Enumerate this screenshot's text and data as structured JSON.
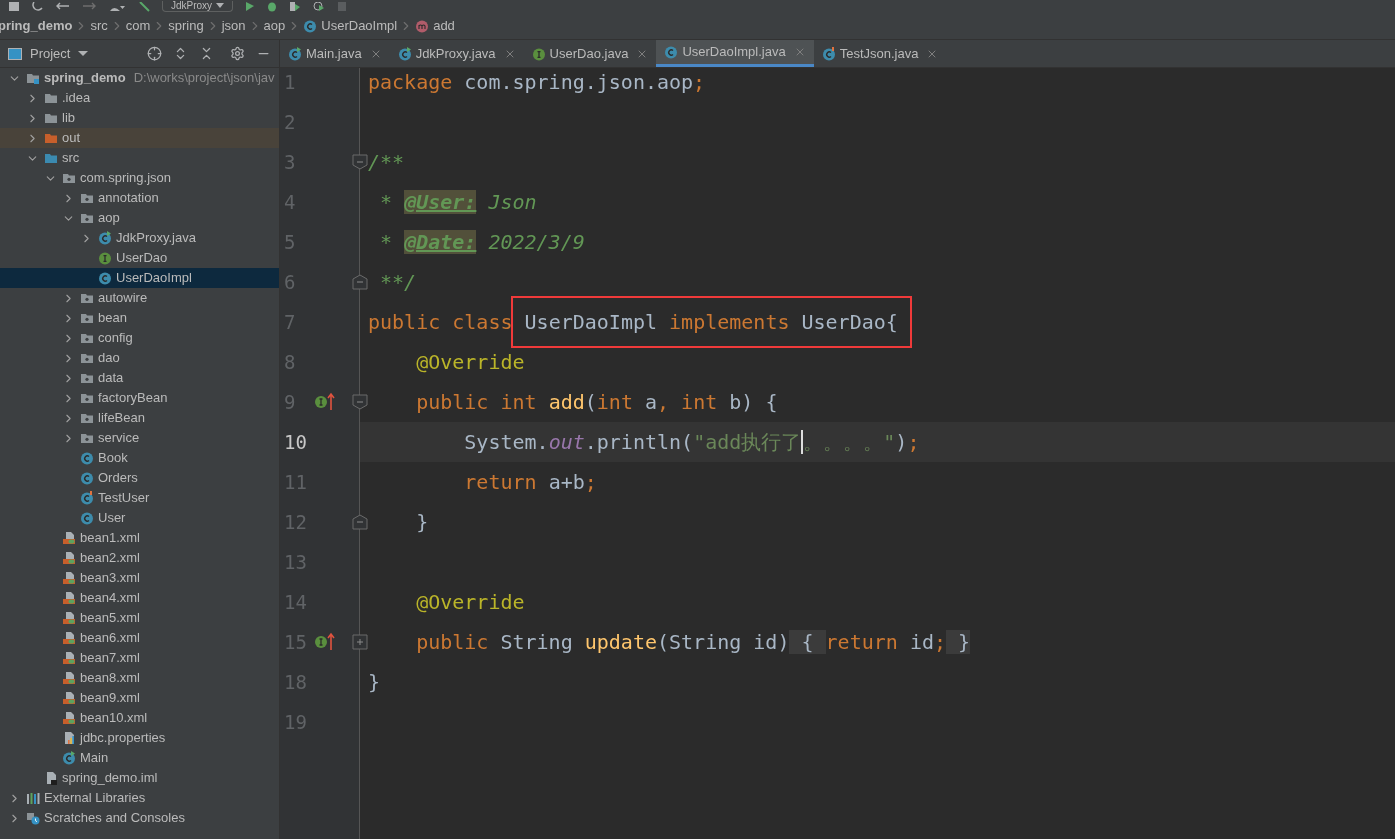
{
  "toolbar": {
    "run_config": "JdkProxy"
  },
  "breadcrumbs": [
    {
      "label": "pring_demo",
      "kind": "project"
    },
    {
      "label": "src",
      "kind": "dir"
    },
    {
      "label": "com",
      "kind": "dir"
    },
    {
      "label": "spring",
      "kind": "dir"
    },
    {
      "label": "json",
      "kind": "dir"
    },
    {
      "label": "aop",
      "kind": "dir"
    },
    {
      "label": "UserDaoImpl",
      "kind": "class"
    },
    {
      "label": "add",
      "kind": "method"
    }
  ],
  "project_panel": {
    "title": "Project",
    "tree": [
      {
        "label": "spring_demo",
        "hint": "D:\\works\\project\\json\\jav",
        "kind": "module",
        "expanded": true,
        "selected": false,
        "children": [
          {
            "label": ".idea",
            "kind": "folder",
            "expanded": false,
            "selected": false
          },
          {
            "label": "lib",
            "kind": "folder",
            "expanded": false,
            "selected": false
          },
          {
            "label": "out",
            "kind": "excluded",
            "expanded": false,
            "selected": false
          },
          {
            "label": "src",
            "kind": "source",
            "expanded": true,
            "selected": false,
            "children": [
              {
                "label": "com.spring.json",
                "kind": "package",
                "expanded": true,
                "selected": false,
                "children": [
                  {
                    "label": "annotation",
                    "kind": "package",
                    "expanded": false,
                    "selected": false
                  },
                  {
                    "label": "aop",
                    "kind": "package",
                    "expanded": true,
                    "selected": false,
                    "children": [
                      {
                        "label": "JdkProxy.java",
                        "kind": "class-run",
                        "expanded": false,
                        "selected": false
                      },
                      {
                        "label": "UserDao",
                        "kind": "interface",
                        "selected": false
                      },
                      {
                        "label": "UserDaoImpl",
                        "kind": "class",
                        "selected": true
                      }
                    ]
                  },
                  {
                    "label": "autowire",
                    "kind": "package",
                    "expanded": false,
                    "selected": false
                  },
                  {
                    "label": "bean",
                    "kind": "package",
                    "expanded": false,
                    "selected": false
                  },
                  {
                    "label": "config",
                    "kind": "package",
                    "expanded": false,
                    "selected": false
                  },
                  {
                    "label": "dao",
                    "kind": "package",
                    "expanded": false,
                    "selected": false
                  },
                  {
                    "label": "data",
                    "kind": "package",
                    "expanded": false,
                    "selected": false
                  },
                  {
                    "label": "factoryBean",
                    "kind": "package",
                    "expanded": false,
                    "selected": false
                  },
                  {
                    "label": "lifeBean",
                    "kind": "package",
                    "expanded": false,
                    "selected": false
                  },
                  {
                    "label": "service",
                    "kind": "package",
                    "expanded": false,
                    "selected": false
                  },
                  {
                    "label": "Book",
                    "kind": "class",
                    "selected": false
                  },
                  {
                    "label": "Orders",
                    "kind": "class",
                    "selected": false
                  },
                  {
                    "label": "TestUser",
                    "kind": "class-test",
                    "selected": false
                  },
                  {
                    "label": "User",
                    "kind": "class",
                    "selected": false
                  }
                ]
              },
              {
                "label": "bean1.xml",
                "kind": "xml",
                "selected": false
              },
              {
                "label": "bean2.xml",
                "kind": "xml",
                "selected": false
              },
              {
                "label": "bean3.xml",
                "kind": "xml",
                "selected": false
              },
              {
                "label": "bean4.xml",
                "kind": "xml",
                "selected": false
              },
              {
                "label": "bean5.xml",
                "kind": "xml",
                "selected": false
              },
              {
                "label": "bean6.xml",
                "kind": "xml",
                "selected": false
              },
              {
                "label": "bean7.xml",
                "kind": "xml",
                "selected": false
              },
              {
                "label": "bean8.xml",
                "kind": "xml",
                "selected": false
              },
              {
                "label": "bean9.xml",
                "kind": "xml",
                "selected": false
              },
              {
                "label": "bean10.xml",
                "kind": "xml",
                "selected": false
              },
              {
                "label": "jdbc.properties",
                "kind": "properties",
                "selected": false
              },
              {
                "label": "Main",
                "kind": "class-run",
                "selected": false
              }
            ]
          },
          {
            "label": "spring_demo.iml",
            "kind": "iml",
            "selected": false
          }
        ]
      },
      {
        "label": "External Libraries",
        "kind": "libraries",
        "expanded": false,
        "selected": false
      },
      {
        "label": "Scratches and Consoles",
        "kind": "scratches",
        "expanded": false,
        "selected": false
      }
    ]
  },
  "editor_tabs": [
    {
      "label": "Main.java",
      "kind": "class-run",
      "selected": false
    },
    {
      "label": "JdkProxy.java",
      "kind": "class-run",
      "selected": false
    },
    {
      "label": "UserDao.java",
      "kind": "interface",
      "selected": false
    },
    {
      "label": "UserDaoImpl.java",
      "kind": "class",
      "selected": true
    },
    {
      "label": "TestJson.java",
      "kind": "class-test",
      "selected": false
    }
  ],
  "code_lines": [
    {
      "number": "1",
      "tokens": [
        {
          "text": "package ",
          "kind": "keyword"
        },
        {
          "text": "com.spring.json.aop",
          "kind": "plain"
        },
        {
          "text": ";",
          "kind": "keyword"
        }
      ]
    },
    {
      "number": "2"
    },
    {
      "number": "3",
      "fold_start": true,
      "tokens": [
        {
          "text": "/**",
          "kind": "comment"
        }
      ]
    },
    {
      "number": "4",
      "tokens": [
        {
          "text": " * ",
          "kind": "comment"
        },
        {
          "text": "@User:",
          "kind": "doctag"
        },
        {
          "text": " Json",
          "kind": "comment"
        }
      ]
    },
    {
      "number": "5",
      "tokens": [
        {
          "text": " * ",
          "kind": "comment"
        },
        {
          "text": "@Date:",
          "kind": "doctag"
        },
        {
          "text": " 2022/3/9",
          "kind": "comment"
        }
      ]
    },
    {
      "number": "6",
      "fold_end": true,
      "tokens": [
        {
          "text": " **/",
          "kind": "comment"
        }
      ]
    },
    {
      "number": "7",
      "tokens": [
        {
          "text": "public class ",
          "kind": "keyword",
          "boxed": false
        },
        {
          "text": "UserDaoImpl ",
          "kind": "plain",
          "boxed": true
        },
        {
          "text": "implements ",
          "kind": "keyword",
          "boxed": true
        },
        {
          "text": "UserDao{",
          "kind": "plain",
          "boxed": true
        }
      ]
    },
    {
      "number": "8",
      "tokens": [
        {
          "text": "    @Override",
          "kind": "annotation"
        }
      ]
    },
    {
      "number": "9",
      "fold_start": true,
      "implements_marker": true,
      "tokens": [
        {
          "text": "    public int ",
          "kind": "keyword"
        },
        {
          "text": "add",
          "kind": "method"
        },
        {
          "text": "(",
          "kind": "plain"
        },
        {
          "text": "int ",
          "kind": "keyword"
        },
        {
          "text": "a",
          "kind": "plain"
        },
        {
          "text": ", ",
          "kind": "keyword"
        },
        {
          "text": "int ",
          "kind": "keyword"
        },
        {
          "text": "b) {",
          "kind": "plain"
        }
      ]
    },
    {
      "number": "10",
      "current": true,
      "tokens": [
        {
          "text": "        System.",
          "kind": "plain"
        },
        {
          "text": "out",
          "kind": "field"
        },
        {
          "text": ".println(",
          "kind": "plain"
        },
        {
          "text": "\"add执行了",
          "kind": "string",
          "caret": true
        },
        {
          "text": "。。。。\"",
          "kind": "string"
        },
        {
          "text": ")",
          "kind": "plain"
        },
        {
          "text": ";",
          "kind": "keyword"
        }
      ]
    },
    {
      "number": "11",
      "tokens": [
        {
          "text": "        return ",
          "kind": "keyword"
        },
        {
          "text": "a+b",
          "kind": "plain"
        },
        {
          "text": ";",
          "kind": "keyword"
        }
      ]
    },
    {
      "number": "12",
      "fold_end": true,
      "tokens": [
        {
          "text": "    }",
          "kind": "plain"
        }
      ]
    },
    {
      "number": "13"
    },
    {
      "number": "14",
      "tokens": [
        {
          "text": "    @Override",
          "kind": "annotation"
        }
      ]
    },
    {
      "number": "15",
      "fold_collapsed": true,
      "implements_marker": true,
      "tokens": [
        {
          "text": "    public ",
          "kind": "keyword"
        },
        {
          "text": "String ",
          "kind": "plain"
        },
        {
          "text": "update",
          "kind": "method"
        },
        {
          "text": "(String id)",
          "kind": "plain"
        },
        {
          "text": " { ",
          "kind": "folded"
        },
        {
          "text": "return ",
          "kind": "keyword"
        },
        {
          "text": "id",
          "kind": "plain"
        },
        {
          "text": ";",
          "kind": "keyword"
        },
        {
          "text": " }",
          "kind": "folded"
        }
      ]
    },
    {
      "number": "18",
      "tokens": [
        {
          "text": "}",
          "kind": "plain"
        }
      ]
    },
    {
      "number": "19"
    }
  ]
}
